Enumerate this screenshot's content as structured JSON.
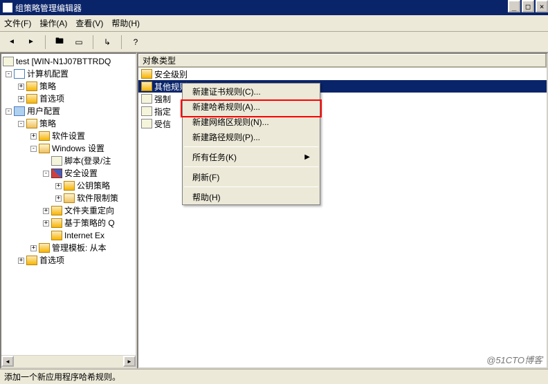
{
  "window": {
    "title": "组策略管理编辑器"
  },
  "menu": {
    "file": "文件(F)",
    "action": "操作(A)",
    "view": "查看(V)",
    "help": "帮助(H)"
  },
  "tree": {
    "root": "test [WIN-N1J07BTTRDQ",
    "computer_cfg": "计算机配置",
    "policies1": "策略",
    "prefs1": "首选项",
    "user_cfg": "用户配置",
    "policies2": "策略",
    "soft_settings": "软件设置",
    "windows_settings": "Windows 设置",
    "scripts": "脚本(登录/注",
    "sec_settings": "安全设置",
    "pubkey": "公钥策略",
    "softrestrict": "软件限制策",
    "folder_redir": "文件夹重定向",
    "policy_qos": "基于策略的 Q",
    "ie": "Internet Ex",
    "admin_tmpl": "管理模板: 从本",
    "prefs2": "首选项"
  },
  "detail": {
    "header": "对象类型",
    "items": [
      "安全级别",
      "其他规则",
      "强制",
      "指定",
      "受信"
    ]
  },
  "context_menu": {
    "cert_rule": "新建证书规则(C)...",
    "hash_rule": "新建哈希规则(A)...",
    "zone_rule": "新建网络区规则(N)...",
    "path_rule": "新建路径规则(P)...",
    "all_tasks": "所有任务(K)",
    "refresh": "刷新(F)",
    "help": "帮助(H)"
  },
  "status": "添加一个新应用程序哈希规则。",
  "watermark": "@51CTO博客"
}
